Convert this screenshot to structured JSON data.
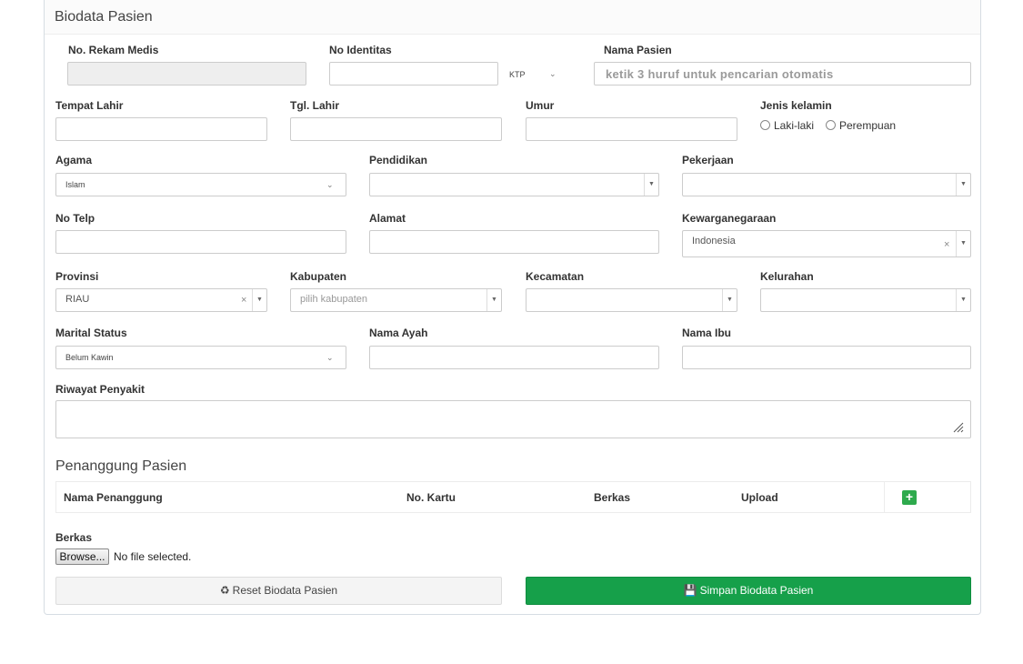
{
  "panel": {
    "title": "Biodata Pasien"
  },
  "fields": {
    "rekam_medis": {
      "label": "No. Rekam Medis",
      "value": ""
    },
    "identitas": {
      "label": "No Identitas",
      "value": "",
      "type_selected": "KTP"
    },
    "nama_pasien": {
      "label": "Nama Pasien",
      "placeholder": "ketik 3 huruf untuk pencarian otomatis"
    },
    "tempat_lahir": {
      "label": "Tempat Lahir",
      "value": ""
    },
    "tgl_lahir": {
      "label": "Tgl. Lahir",
      "value": ""
    },
    "umur": {
      "label": "Umur",
      "value": ""
    },
    "jenis_kelamin": {
      "label": "Jenis kelamin",
      "options": [
        "Laki-laki",
        "Perempuan"
      ]
    },
    "agama": {
      "label": "Agama",
      "selected": "Islam"
    },
    "pendidikan": {
      "label": "Pendidikan",
      "selected": ""
    },
    "pekerjaan": {
      "label": "Pekerjaan",
      "selected": ""
    },
    "no_telp": {
      "label": "No Telp",
      "value": ""
    },
    "alamat": {
      "label": "Alamat",
      "value": ""
    },
    "kewarganegaraan": {
      "label": "Kewarganegaraan",
      "selected": "Indonesia"
    },
    "provinsi": {
      "label": "Provinsi",
      "selected": "RIAU"
    },
    "kabupaten": {
      "label": "Kabupaten",
      "placeholder": "pilih kabupaten"
    },
    "kecamatan": {
      "label": "Kecamatan",
      "selected": ""
    },
    "kelurahan": {
      "label": "Kelurahan",
      "selected": ""
    },
    "marital_status": {
      "label": "Marital Status",
      "selected": "Belum Kawin"
    },
    "nama_ayah": {
      "label": "Nama Ayah",
      "value": ""
    },
    "nama_ibu": {
      "label": "Nama Ibu",
      "value": ""
    },
    "riwayat_penyakit": {
      "label": "Riwayat Penyakit",
      "value": ""
    }
  },
  "penanggung": {
    "title": "Penanggung Pasien",
    "columns": [
      "Nama Penanggung",
      "No. Kartu",
      "Berkas",
      "Upload"
    ],
    "add_label": "+"
  },
  "berkas": {
    "label": "Berkas",
    "browse_label": "Browse...",
    "no_file_text": "No file selected."
  },
  "buttons": {
    "reset": "Reset Biodata Pasien",
    "save": "Simpan Biodata Pasien"
  },
  "colors": {
    "save_green": "#16a04a",
    "add_green": "#2eaa4d"
  },
  "icons": {
    "reset": "recycle-icon",
    "save": "floppy-disk-icon",
    "add": "plus-icon",
    "dropdown": "chevron-down-icon",
    "clear": "clear-x-icon"
  }
}
